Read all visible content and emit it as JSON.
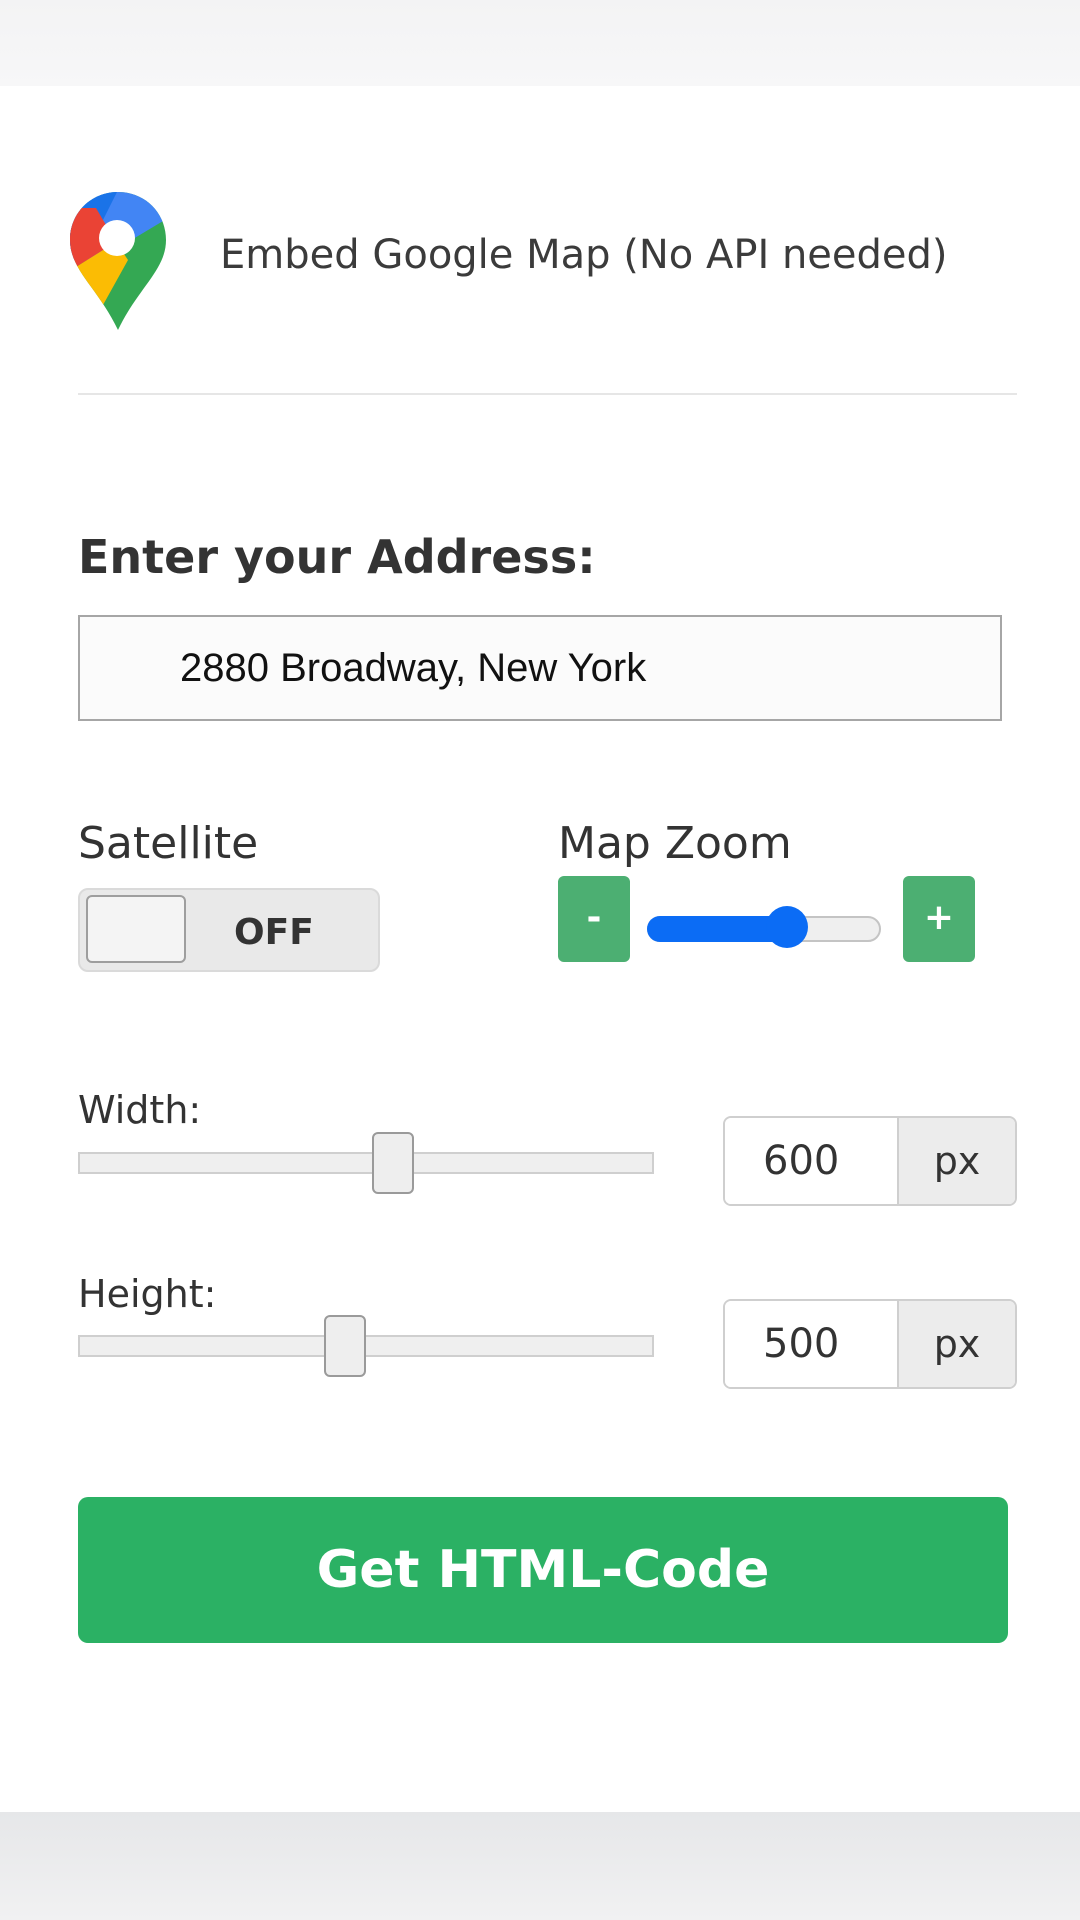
{
  "header": {
    "title": "Embed Google Map (No API needed)",
    "logo_icon": "google-maps-pin-icon"
  },
  "address": {
    "label": "Enter your Address:",
    "value": "2880 Broadway, New York"
  },
  "satellite": {
    "label": "Satellite",
    "state": "OFF"
  },
  "zoom": {
    "label": "Map Zoom",
    "minus_label": "-",
    "plus_label": "+",
    "level_fraction": 0.62
  },
  "width": {
    "label": "Width:",
    "value": "600",
    "unit": "px",
    "slider_fraction": 0.55
  },
  "height": {
    "label": "Height:",
    "value": "500",
    "unit": "px",
    "slider_fraction": 0.46
  },
  "cta": {
    "label": "Get HTML-Code"
  },
  "colors": {
    "accent_green": "#2bb164",
    "zoom_button_green": "#4caf72",
    "slider_blue": "#0b6cf5"
  }
}
